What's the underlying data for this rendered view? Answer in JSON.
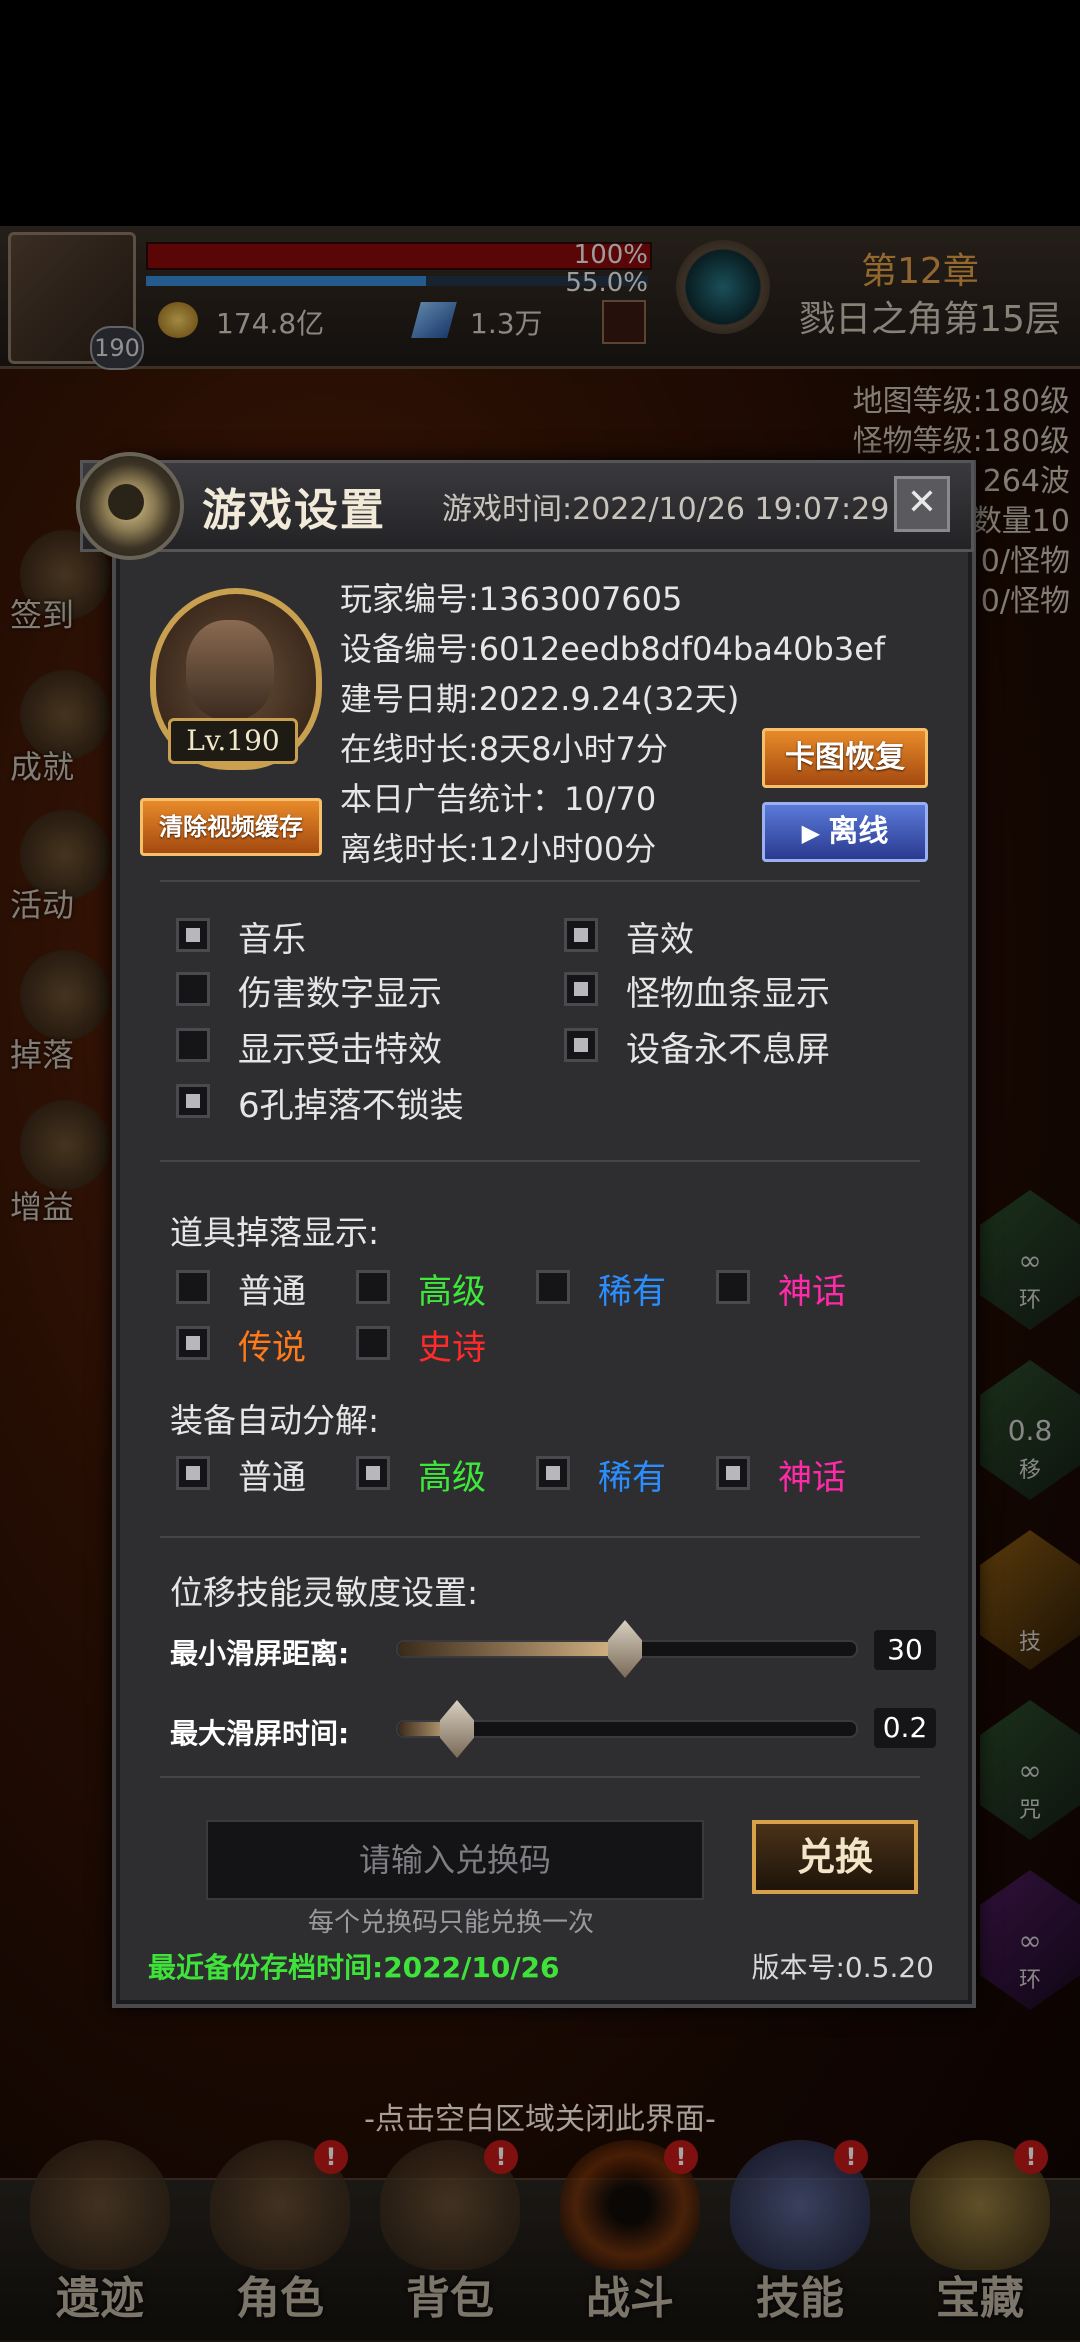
{
  "hud": {
    "level": "190",
    "hp_percent": "100%",
    "xp_percent": "55.0%",
    "gold": "174.8亿",
    "gems": "1.3万",
    "chapter": "第12章",
    "stage": "戮日之角第15层",
    "stats": [
      "地图等级:180级",
      "怪物等级:180级",
      "264波",
      "数量10",
      "0/怪物",
      "0/怪物"
    ],
    "left_menu": [
      "签到",
      "成就",
      "活动",
      "掉落",
      "增益"
    ],
    "right_menu": [
      {
        "top": "∞",
        "bottom": "环"
      },
      {
        "top": "0.8",
        "bottom": "移"
      },
      {
        "top": "",
        "bottom": "技"
      },
      {
        "top": "∞",
        "bottom": "咒"
      },
      {
        "top": "∞",
        "bottom": "环"
      }
    ]
  },
  "dialog": {
    "title": "游戏设置",
    "game_time": "游戏时间:2022/10/26 19:07:29",
    "close": "✕",
    "avatar_level": "Lv.190",
    "clear_cache_button": "清除视频缓存",
    "info": {
      "player_id": "玩家编号:1363007605",
      "device_id": "设备编号:6012eedb8df04ba40b3ef",
      "created": "建号日期:2022.9.24(32天)",
      "online": "在线时长:8天8小时7分",
      "ads": "本日广告统计：10/70",
      "offline": "离线时长:12小时00分"
    },
    "map_fix_button": "卡图恢复",
    "offline_button": "离线",
    "options": [
      {
        "label": "音乐",
        "checked": true
      },
      {
        "label": "音效",
        "checked": true
      },
      {
        "label": "伤害数字显示",
        "checked": false
      },
      {
        "label": "怪物血条显示",
        "checked": true
      },
      {
        "label": "显示受击特效",
        "checked": false
      },
      {
        "label": "设备永不息屏",
        "checked": true
      },
      {
        "label": "6孔掉落不锁装",
        "checked": true
      }
    ],
    "drop_title": "道具掉落显示:",
    "drop_options": [
      {
        "label": "普通",
        "checked": false,
        "color": "#e6e6e6"
      },
      {
        "label": "高级",
        "checked": false,
        "color": "#3ee83a"
      },
      {
        "label": "稀有",
        "checked": false,
        "color": "#2a8eff"
      },
      {
        "label": "神话",
        "checked": false,
        "color": "#ff2aa8"
      },
      {
        "label": "传说",
        "checked": true,
        "color": "#ff7a1a"
      },
      {
        "label": "史诗",
        "checked": false,
        "color": "#ff2a2a"
      }
    ],
    "decompose_title": "装备自动分解:",
    "decompose_options": [
      {
        "label": "普通",
        "checked": true,
        "color": "#e6e6e6"
      },
      {
        "label": "高级",
        "checked": true,
        "color": "#3ee83a"
      },
      {
        "label": "稀有",
        "checked": true,
        "color": "#2a8eff"
      },
      {
        "label": "神话",
        "checked": true,
        "color": "#ff2aa8"
      }
    ],
    "sensitivity_title": "位移技能灵敏度设置:",
    "sliders": [
      {
        "label": "最小滑屏距离:",
        "value": "30",
        "fraction": 0.5
      },
      {
        "label": "最大滑屏时间:",
        "value": "0.2",
        "fraction": 0.13
      }
    ],
    "redeem_placeholder": "请输入兑换码",
    "redeem_button": "兑换",
    "redeem_hint": "每个兑换码只能兑换一次",
    "backup": "最近备份存档时间:2022/10/26",
    "version": "版本号:0.5.20"
  },
  "close_hint": "-点击空白区域关闭此界面-",
  "bottom_nav": [
    {
      "label": "遗迹",
      "badge": ""
    },
    {
      "label": "角色",
      "badge": "!"
    },
    {
      "label": "背包",
      "badge": "!"
    },
    {
      "label": "战斗",
      "badge": "!"
    },
    {
      "label": "技能",
      "badge": "!"
    },
    {
      "label": "宝藏",
      "badge": "!"
    }
  ]
}
